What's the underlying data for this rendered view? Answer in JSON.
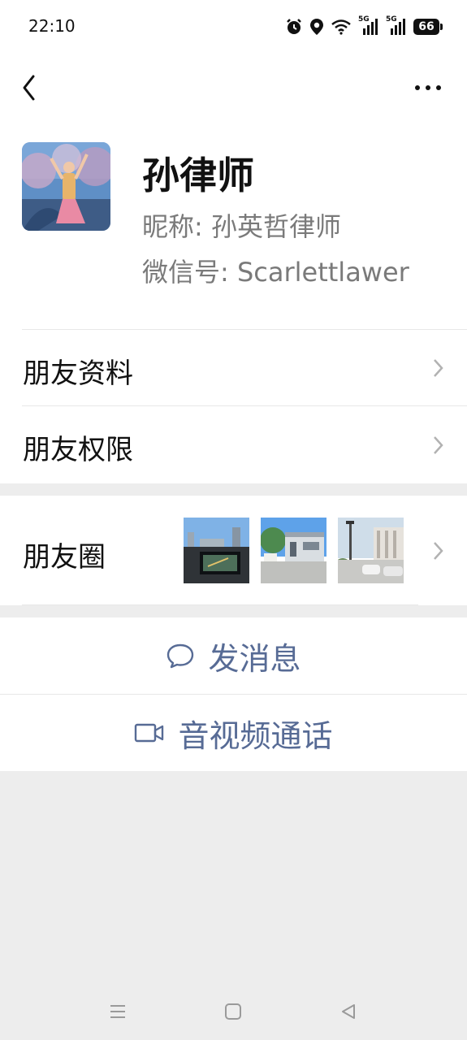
{
  "status_bar": {
    "time": "22:10",
    "network_label_1": "5G",
    "network_label_2": "5G",
    "battery": "66"
  },
  "profile": {
    "name": "孙律师",
    "nickname": "昵称:  孙英哲律师",
    "wechat_id": "微信号:  Scarlettlawer"
  },
  "menu": {
    "friend_info": "朋友资料",
    "friend_permissions": "朋友权限",
    "moments": "朋友圈"
  },
  "actions": {
    "send_message": "发消息",
    "video_call": "音视频通话"
  },
  "colors": {
    "link_blue": "#576b95",
    "background_gray": "#ededed"
  }
}
